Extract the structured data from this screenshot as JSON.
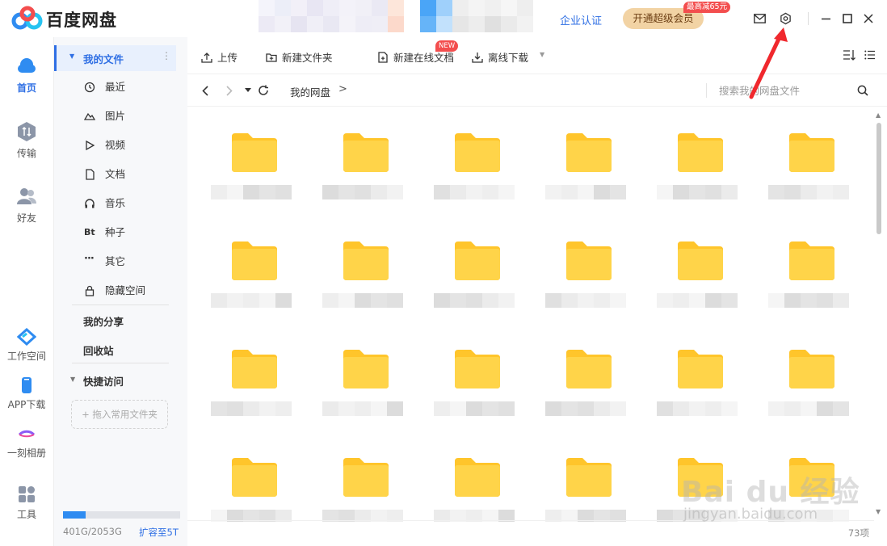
{
  "app": {
    "title": "百度网盘",
    "enterprise_label": "企业认证",
    "vip_button": "开通超级会员",
    "vip_badge": "最高减65元"
  },
  "icons": {
    "mail": "mail-icon",
    "settings": "settings-icon",
    "minimize": "minimize-icon",
    "maximize": "maximize-icon",
    "close": "close-icon"
  },
  "leftnav": {
    "home": "首页",
    "transfer": "传输",
    "friends": "好友",
    "workspace": "工作空间",
    "app_download": "APP下载",
    "album": "一刻相册",
    "tools": "工具"
  },
  "sidebar": {
    "my_files": "我的文件",
    "categories": [
      "最近",
      "图片",
      "视频",
      "文档",
      "音乐",
      "种子",
      "其它",
      "隐藏空间"
    ],
    "my_share": "我的分享",
    "recycle": "回收站",
    "quick_access": "快捷访问",
    "drop_hint": "+ 拖入常用文件夹",
    "storage_text": "401G/2053G",
    "storage_used_fraction": 0.195,
    "expand_link": "扩容至5T"
  },
  "toolbar": {
    "upload": "上传",
    "new_folder": "新建文件夹",
    "new_online_doc": "新建在线文档",
    "new_badge": "NEW",
    "offline_download": "离线下载"
  },
  "path": {
    "crumb": "我的网盘",
    "separator": ">",
    "search_placeholder": "搜索我的网盘文件"
  },
  "content": {
    "item_count": "73项",
    "visible_folders": 24
  },
  "watermark": {
    "text": "Bai du 经验",
    "url": "jingyan.baidu.com"
  },
  "colors": {
    "accent": "#2f6fe4",
    "folder": "#ffd449",
    "folder_dark": "#ffc52b",
    "vip": "#f2d3a4",
    "badge": "#f34e4e"
  }
}
